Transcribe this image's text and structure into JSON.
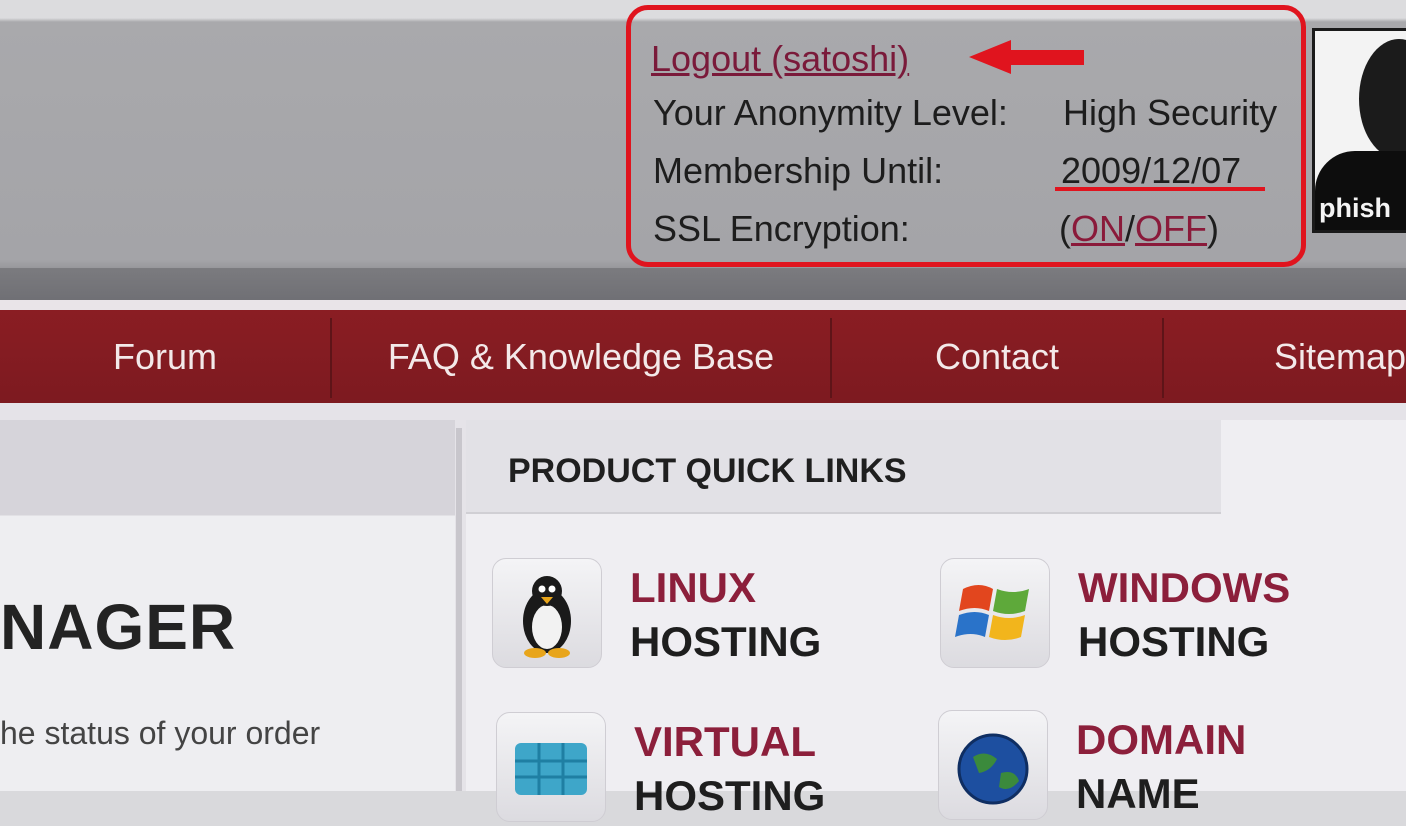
{
  "account": {
    "logout_label": "Logout (satoshi)",
    "anonymity_label": "Your Anonymity Level:",
    "anonymity_value": "High Security",
    "membership_label": "Membership Until:",
    "membership_value": "2009/12/07",
    "ssl_label": "SSL Encryption:",
    "ssl_open": "(",
    "ssl_on": "ON",
    "ssl_sep": "/",
    "ssl_off": "OFF",
    "ssl_close": ")"
  },
  "avatar": {
    "username": "phish"
  },
  "nav": {
    "items": [
      {
        "label": "Forum"
      },
      {
        "label": "FAQ & Knowledge Base"
      },
      {
        "label": "Contact"
      },
      {
        "label": "Sitemap"
      }
    ]
  },
  "left_panel": {
    "title": "NAGER",
    "subtitle": "he status of your order"
  },
  "quick_links": {
    "title": "PRODUCT QUICK LINKS",
    "items": [
      {
        "line1": "LINUX",
        "line2": "HOSTING",
        "icon": "penguin-icon"
      },
      {
        "line1": "WINDOWS",
        "line2": "HOSTING",
        "icon": "windows-logo-icon"
      },
      {
        "line1": "VIRTUAL",
        "line2": "HOSTING",
        "icon": "cubes-icon"
      },
      {
        "line1": "DOMAIN",
        "line2": "NAME",
        "icon": "globe-icon"
      }
    ]
  },
  "colors": {
    "nav_bg": "#8a1d23",
    "highlight_red": "#e0141e",
    "link_maroon": "#7a1a3a",
    "product_accent": "#8c1f3b"
  }
}
